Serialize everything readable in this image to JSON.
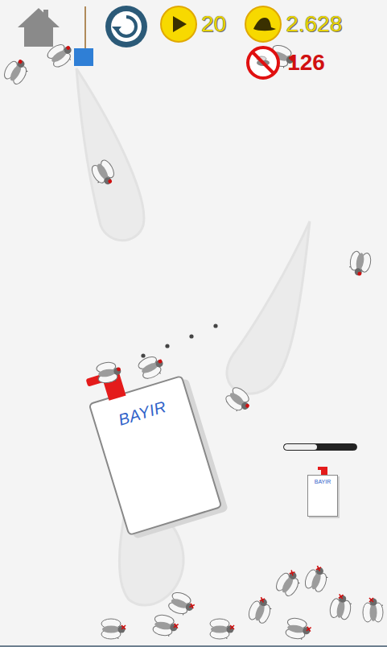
{
  "hud": {
    "counters": [
      {
        "name": "plays",
        "value": "20"
      },
      {
        "name": "coins",
        "value": "2.628"
      }
    ],
    "kills": "126"
  },
  "spray_can": {
    "label": "BAYIR"
  },
  "refill": {
    "label": "BAYIR",
    "level": 0.45
  },
  "flies": [
    {
      "dead": false
    },
    {
      "dead": false
    },
    {
      "dead": false
    },
    {
      "dead": false
    },
    {
      "dead": false
    },
    {
      "dead": false
    },
    {
      "dead": false
    },
    {
      "dead": false
    },
    {
      "dead": true
    },
    {
      "dead": true
    },
    {
      "dead": true
    },
    {
      "dead": true
    },
    {
      "dead": true
    },
    {
      "dead": true
    },
    {
      "dead": true
    },
    {
      "dead": true
    },
    {
      "dead": true
    },
    {
      "dead": true
    }
  ]
}
